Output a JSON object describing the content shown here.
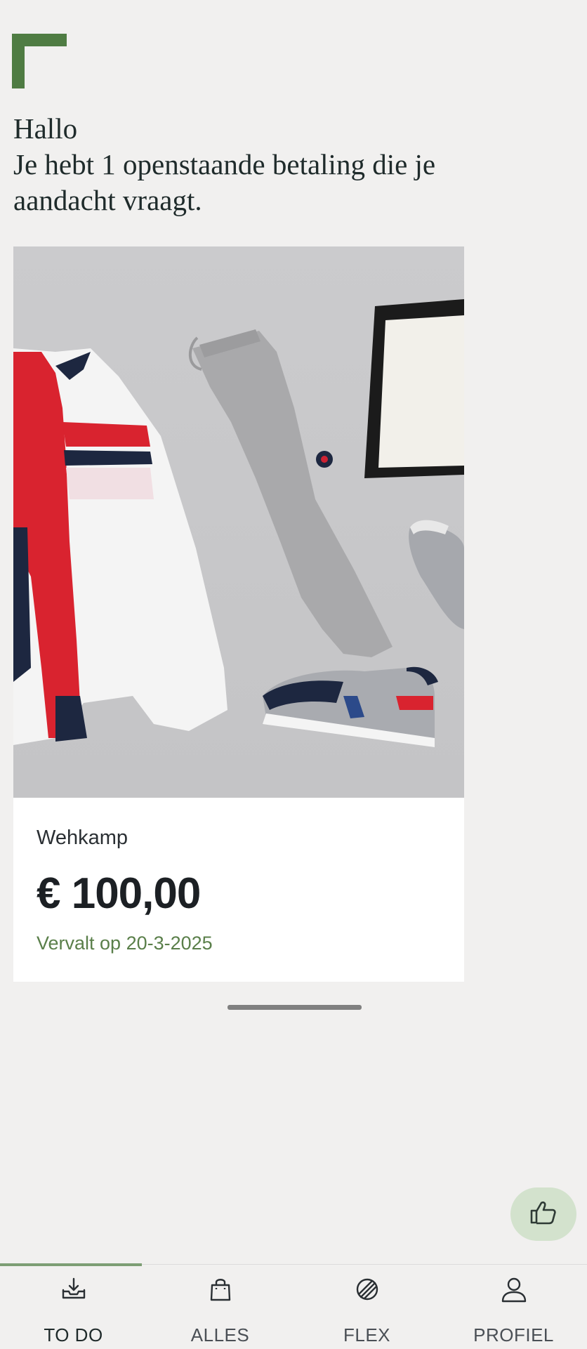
{
  "greeting": {
    "line1": "Hallo",
    "line2": "Je hebt 1 openstaande betaling die je",
    "line3": "aandacht vraagt."
  },
  "payment_card": {
    "merchant": "Wehkamp",
    "amount": "€ 100,00",
    "due": "Vervalt op 20-3-2025",
    "image_description_icon": "product-photo"
  },
  "fab": {
    "icon": "thumbs-up-icon"
  },
  "nav": {
    "active_index": 0,
    "items": [
      {
        "label": "TO DO",
        "icon": "inbox-download-icon"
      },
      {
        "label": "ALLES",
        "icon": "shopping-bag-icon"
      },
      {
        "label": "FLEX",
        "icon": "flex-icon"
      },
      {
        "label": "PROFIEL",
        "icon": "person-icon"
      }
    ]
  },
  "colors": {
    "accent_green": "#4f7c43",
    "due_text": "#5a7f4a",
    "fab_bg": "#d3e2cd",
    "background": "#f1f0ef"
  }
}
